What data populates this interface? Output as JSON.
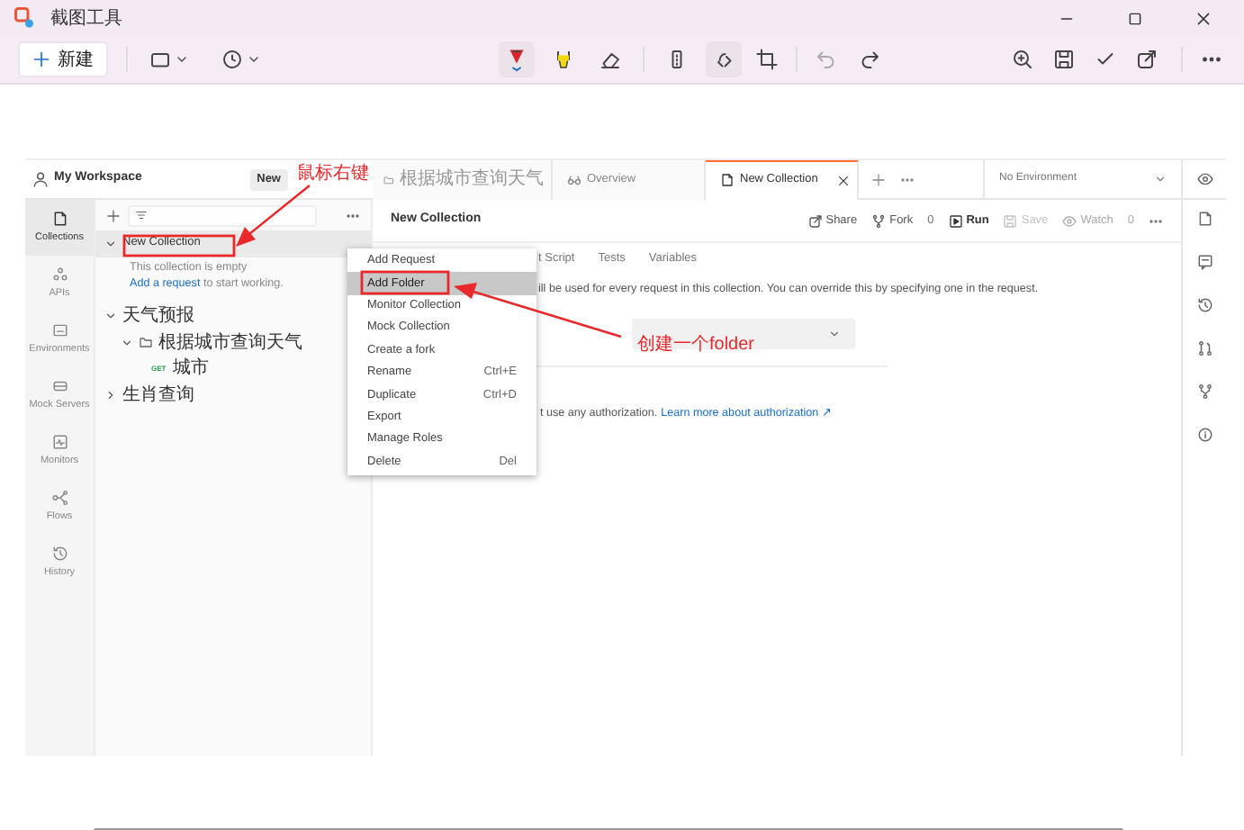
{
  "window": {
    "title": "截图工具"
  },
  "toolbar": {
    "new_button": "新建"
  },
  "workspace": {
    "name": "My Workspace",
    "new_button": "New"
  },
  "nav": [
    {
      "label": "Collections",
      "selected": true
    },
    {
      "label": "APIs",
      "selected": false
    },
    {
      "label": "Environments",
      "selected": false
    },
    {
      "label": "Mock Servers",
      "selected": false
    },
    {
      "label": "Monitors",
      "selected": false
    },
    {
      "label": "Flows",
      "selected": false
    },
    {
      "label": "History",
      "selected": false
    }
  ],
  "tree": [
    {
      "label": "New Collection",
      "kind": "collection",
      "expanded": true,
      "selected": true,
      "empty_note": "This collection is empty",
      "empty_link": "Add a request",
      "empty_suffix": " to start working."
    },
    {
      "label": "天气预报",
      "kind": "collection",
      "expanded": true,
      "selected": false,
      "children": [
        {
          "label": "根据城市查询天气",
          "kind": "folder",
          "expanded": true,
          "selected": false,
          "children": [
            {
              "label": "城市",
              "kind": "request",
              "method": "GET",
              "selected": false
            }
          ]
        }
      ]
    },
    {
      "label": "生肖查询",
      "kind": "collection",
      "expanded": false,
      "selected": false
    }
  ],
  "tabs": [
    {
      "label": "根据城市查询天气",
      "kind": "folder",
      "selected": false
    },
    {
      "label": "Overview",
      "kind": "overview",
      "selected": false
    },
    {
      "label": "New Collection",
      "kind": "collection",
      "selected": true
    }
  ],
  "environment": "No Environment",
  "collection_header": {
    "title": "New Collection",
    "share": "Share",
    "fork": "Fork",
    "fork_count": "0",
    "run": "Run",
    "save": "Save",
    "save_disabled": true,
    "watch": "Watch",
    "watch_count": "0"
  },
  "subtabs": [
    {
      "label": "t Script",
      "selected": false
    },
    {
      "label": "Tests",
      "selected": false
    },
    {
      "label": "Variables",
      "selected": false
    }
  ],
  "description": "ill be used for every request in this collection. You can override this by specifying one in the request.",
  "auth_note": "t use any authorization.",
  "auth_link": "Learn more about authorization ↗",
  "context_menu": [
    {
      "label": "Add Request",
      "selected": false
    },
    {
      "label": "Add Folder",
      "selected": true
    },
    {
      "label": "Monitor Collection",
      "selected": false
    },
    {
      "label": "Mock Collection",
      "selected": false
    },
    {
      "label": "Create a fork",
      "selected": false
    },
    {
      "label": "Rename",
      "shortcut": "Ctrl+E",
      "selected": false
    },
    {
      "label": "Duplicate",
      "shortcut": "Ctrl+D",
      "selected": false
    },
    {
      "label": "Export",
      "selected": false
    },
    {
      "label": "Manage Roles",
      "selected": false
    },
    {
      "label": "Delete",
      "shortcut": "Del",
      "selected": false
    }
  ],
  "annotations": [
    {
      "text": "鼠标右键",
      "kind": "right-click"
    },
    {
      "text": "创建一个folder",
      "kind": "add-folder"
    }
  ]
}
